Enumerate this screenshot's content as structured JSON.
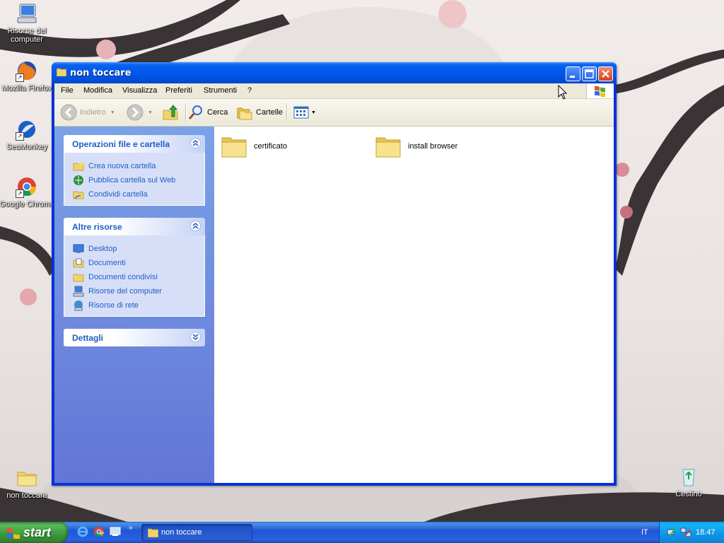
{
  "desktop": {
    "icons": [
      {
        "label": "Risorse del computer"
      },
      {
        "label": "Mozilla Firefox"
      },
      {
        "label": "SeaMonkey"
      },
      {
        "label": "Google Chrome"
      },
      {
        "label": "non toccare"
      },
      {
        "label": "Cestino"
      }
    ]
  },
  "window": {
    "title": "non toccare",
    "menu": [
      "File",
      "Modifica",
      "Visualizza",
      "Preferiti",
      "Strumenti",
      "?"
    ],
    "toolbar": {
      "back": "Indietro",
      "search": "Cerca",
      "folders": "Cartelle"
    },
    "sidebar": {
      "file_tasks": {
        "title": "Operazioni file e cartella",
        "items": [
          "Crea nuova cartella",
          "Pubblica cartella sul Web",
          "Condividi cartella"
        ]
      },
      "other_places": {
        "title": "Altre risorse",
        "items": [
          "Desktop",
          "Documenti",
          "Documenti condivisi",
          "Risorse del computer",
          "Risorse di rete"
        ]
      },
      "details": {
        "title": "Dettagli"
      }
    },
    "files": [
      {
        "name": "certificato",
        "icon": "folder-icon"
      },
      {
        "name": "install browser",
        "icon": "folder-icon"
      }
    ]
  },
  "taskbar": {
    "start_label": "start",
    "task_button": "non toccare",
    "language": "IT",
    "clock": "18.47"
  }
}
